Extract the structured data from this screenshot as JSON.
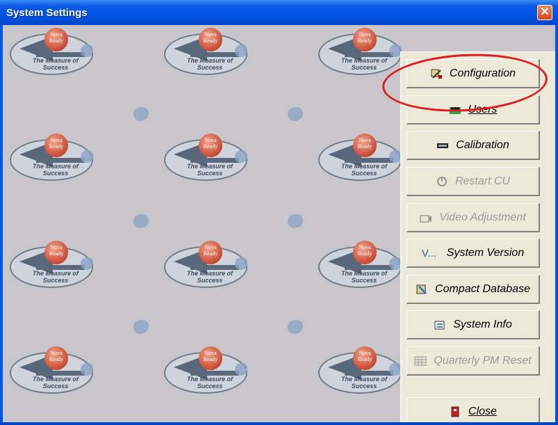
{
  "window": {
    "title": "System Settings",
    "close_glyph": "✕"
  },
  "watermark": {
    "ball_text_line1": "Nova",
    "ball_text_line2": "Ready",
    "tagline_line1": "The Measure of",
    "tagline_line2": "Success"
  },
  "buttons": [
    {
      "label": "Configuration",
      "icon": "wrench-config-icon",
      "enabled": true
    },
    {
      "label": "Users",
      "icon": "users-icon",
      "enabled": true
    },
    {
      "label": "Calibration",
      "icon": "calibration-icon",
      "enabled": true
    },
    {
      "label": "Restart CU",
      "icon": "restart-icon",
      "enabled": false
    },
    {
      "label": "Video Adjustment",
      "icon": "camera-icon",
      "enabled": false
    },
    {
      "label": "System Version",
      "icon_text": "V...",
      "enabled": true
    },
    {
      "label": "Compact Database",
      "icon": "database-icon",
      "enabled": true
    },
    {
      "label": "System Info",
      "icon": "info-icon",
      "enabled": true
    },
    {
      "label": "Quarterly PM Reset",
      "icon": "grid-icon",
      "enabled": false
    },
    {
      "label": "Close",
      "icon": "exit-door-icon",
      "enabled": true
    }
  ],
  "annotation": {
    "color": "#e01c1c",
    "target": "Configuration"
  },
  "colors": {
    "titlebar": "#0054e3",
    "panel": "#ece9d8",
    "background": "#c8c6cb"
  }
}
